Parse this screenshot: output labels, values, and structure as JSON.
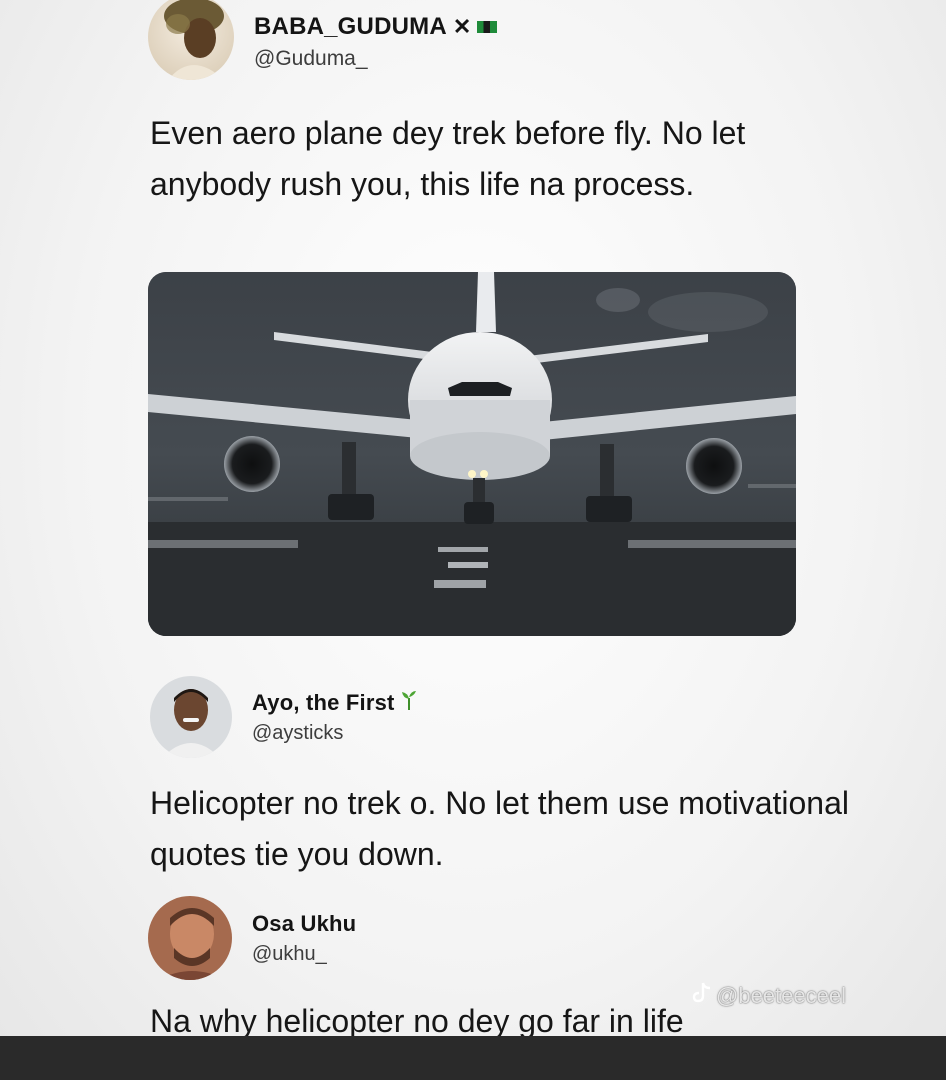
{
  "posts": [
    {
      "display_name": "BABA_GUDUMA",
      "badges": [
        "x-icon",
        "flag-icon"
      ],
      "handle": "@Guduma_",
      "text": "Even aero plane dey trek before fly. No let anybody rush you, this life na process.",
      "media": "airplane-on-runway-image"
    },
    {
      "display_name": "Ayo, the First",
      "badges": [
        "plant-icon"
      ],
      "handle": "@aysticks",
      "text": "Helicopter no trek o. No let them use motivational quotes tie you down."
    },
    {
      "display_name": "Osa Ukhu",
      "badges": [],
      "handle": "@ukhu_",
      "text": "Na why helicopter no dey go far in life"
    }
  ],
  "watermark": {
    "icon": "tiktok-icon",
    "text": "@beeteeceel"
  },
  "colors": {
    "text": "#161616",
    "handle": "#3d3d3d",
    "bottom_bar": "#2a2a2a"
  }
}
